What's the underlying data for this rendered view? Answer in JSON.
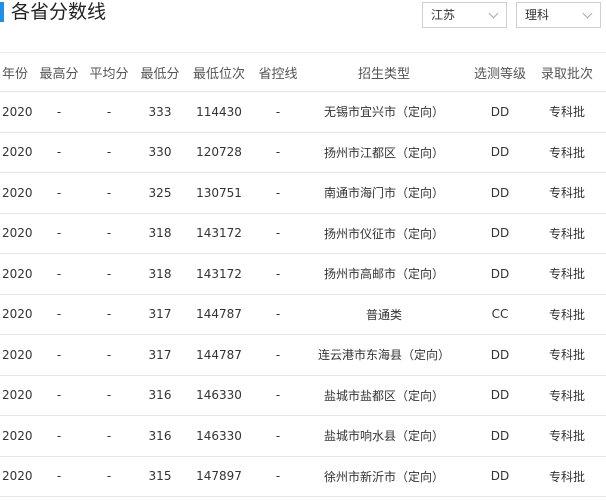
{
  "page": {
    "title": "各省分数线",
    "accent_color": "#1e90e6"
  },
  "filters": {
    "province": "江苏",
    "subject": "理科"
  },
  "table": {
    "headers": [
      "年份",
      "最高分",
      "平均分",
      "最低分",
      "最低位次",
      "省控线",
      "招生类型",
      "选测等级",
      "录取批次"
    ],
    "rows": [
      [
        "2020",
        "-",
        "-",
        "333",
        "114430",
        "-",
        "无锡市宜兴市（定向）",
        "DD",
        "专科批"
      ],
      [
        "2020",
        "-",
        "-",
        "330",
        "120728",
        "-",
        "扬州市江都区（定向）",
        "DD",
        "专科批"
      ],
      [
        "2020",
        "-",
        "-",
        "325",
        "130751",
        "-",
        "南通市海门市（定向）",
        "DD",
        "专科批"
      ],
      [
        "2020",
        "-",
        "-",
        "318",
        "143172",
        "-",
        "扬州市仪征市（定向）",
        "DD",
        "专科批"
      ],
      [
        "2020",
        "-",
        "-",
        "318",
        "143172",
        "-",
        "扬州市高邮市（定向）",
        "DD",
        "专科批"
      ],
      [
        "2020",
        "-",
        "-",
        "317",
        "144787",
        "-",
        "普通类",
        "CC",
        "专科批"
      ],
      [
        "2020",
        "-",
        "-",
        "317",
        "144787",
        "-",
        "连云港市东海县（定向）",
        "DD",
        "专科批"
      ],
      [
        "2020",
        "-",
        "-",
        "316",
        "146330",
        "-",
        "盐城市盐都区（定向）",
        "DD",
        "专科批"
      ],
      [
        "2020",
        "-",
        "-",
        "316",
        "146330",
        "-",
        "盐城市响水县（定向）",
        "DD",
        "专科批"
      ],
      [
        "2020",
        "-",
        "-",
        "315",
        "147897",
        "-",
        "徐州市新沂市（定向）",
        "DD",
        "专科批"
      ]
    ]
  }
}
